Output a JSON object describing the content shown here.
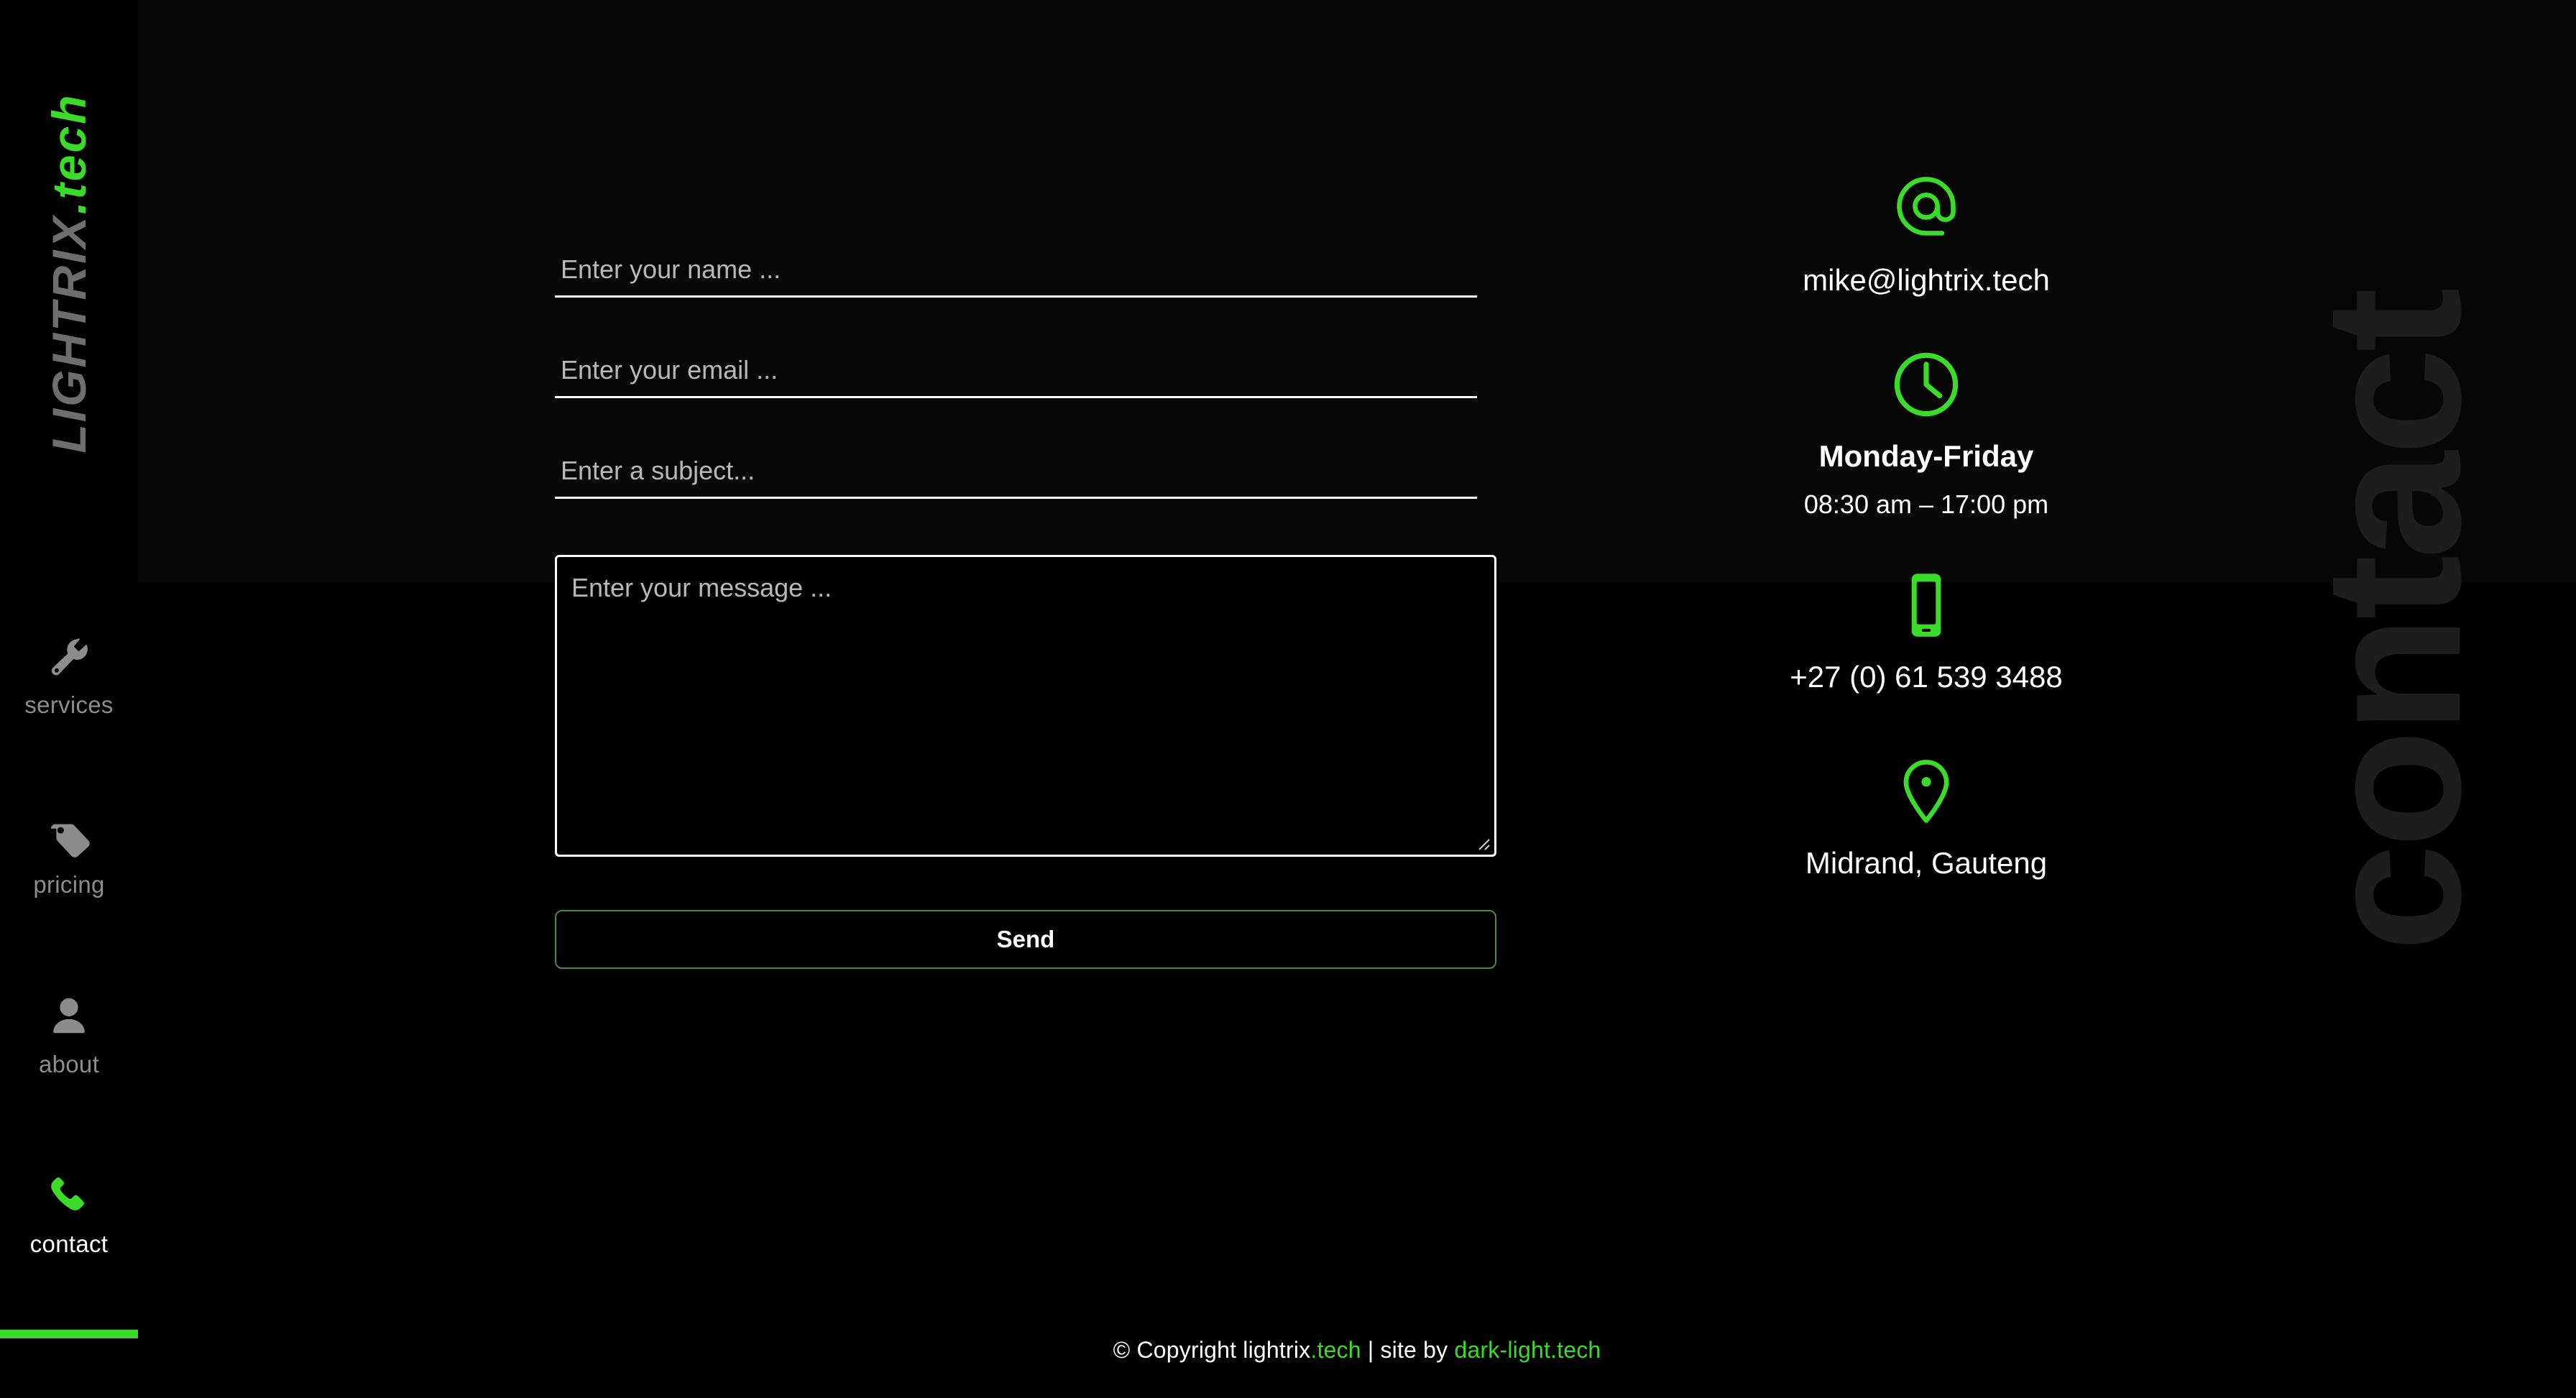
{
  "brand": {
    "logo_name": "LIGHTRIX",
    "logo_tld": ".tech",
    "accent_color": "#3bdb2a",
    "muted_color": "#6e6e6e"
  },
  "watermark": {
    "text": "contact",
    "color": "#1d1d1d"
  },
  "sidebar": {
    "items": [
      {
        "id": "services",
        "label": "services",
        "icon": "wrench-icon",
        "active": false
      },
      {
        "id": "pricing",
        "label": "pricing",
        "icon": "tag-icon",
        "active": false
      },
      {
        "id": "about",
        "label": "about",
        "icon": "person-icon",
        "active": false
      },
      {
        "id": "contact",
        "label": "contact",
        "icon": "phone-icon",
        "active": true
      }
    ]
  },
  "form": {
    "name": {
      "placeholder": "Enter your name ...",
      "value": ""
    },
    "email": {
      "placeholder": "Enter your email ...",
      "value": ""
    },
    "subject": {
      "placeholder": "Enter a subject...",
      "value": ""
    },
    "message": {
      "placeholder": "Enter your message ...",
      "value": ""
    },
    "send_label": "Send"
  },
  "info": {
    "email": {
      "icon": "at-icon",
      "value": "mike@lightrix.tech"
    },
    "hours": {
      "icon": "clock-icon",
      "days": "Monday-Friday",
      "time": "08:30 am – 17:00 pm"
    },
    "phone": {
      "icon": "mobile-icon",
      "value": "+27 (0) 61 539 3488"
    },
    "location": {
      "icon": "map-pin-icon",
      "value": "Midrand, Gauteng"
    }
  },
  "footer": {
    "copyright": "© Copyright lightrix",
    "copyright_tld": ".tech",
    "separator": " | site by ",
    "site_by": "dark-light.tech"
  }
}
